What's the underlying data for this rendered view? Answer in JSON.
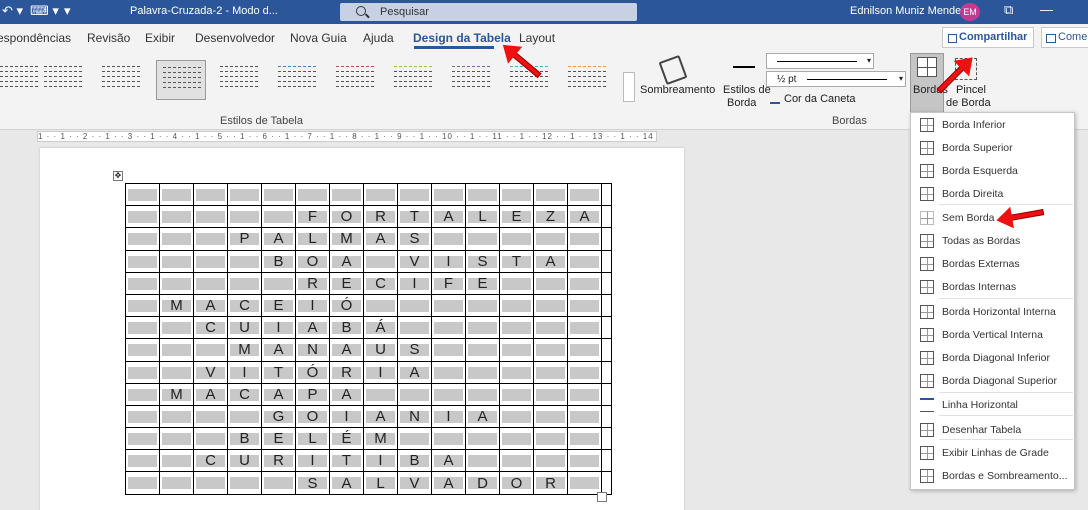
{
  "titlebar": {
    "qa_undo": "↶ ▾",
    "qa_touch": "⌨ ▾",
    "qa_more": "▾",
    "doc_title": "Palavra-Cruzada-2 - Modo d...",
    "search_placeholder": "Pesquisar",
    "user_name": "Ednilson Muniz Mendes",
    "avatar_initials": "EM",
    "restore": "⧉",
    "minimize": "—"
  },
  "tabs": [
    {
      "label": "espondências"
    },
    {
      "label": "Revisão"
    },
    {
      "label": "Exibir"
    },
    {
      "label": "Desenvolvedor"
    },
    {
      "label": "Nova Guia"
    },
    {
      "label": "Ajuda"
    },
    {
      "label": "Design da Tabela"
    },
    {
      "label": "Layout"
    }
  ],
  "share_label": "Compartilhar",
  "comment_label": "Come",
  "ribbon": {
    "styles_group_label": "Estilos de Tabela",
    "shading_label": "Sombreamento",
    "border_styles_label_1": "Estilos de",
    "border_styles_label_2": "Borda",
    "pen_weight": "½ pt",
    "pen_color_label": "Cor da Caneta",
    "borders_button_label": "Bordas",
    "border_painter_label_1": "Pincel",
    "border_painter_label_2": "de Borda",
    "borders_group_label": "Bordas"
  },
  "ruler_text": "1 · · 1 · · 2 · · 1 · · 3 · · 1 · · 4 · · 1 · · 5 · · 1 · · 6 · · 1 · · 7 · · 1 · · 8 · · 1 · · 9 · · 1 · · 10 · · 1 · · 11 · · 1 · · 12 · · 1 · · 13 · · 1 · · 14 · · 1 · · 15 · · 1 · · 16 · · 1 · · 17 · ·",
  "crossword": {
    "rows": [
      [
        "",
        "",
        "",
        "",
        "",
        "",
        "",
        "",
        "",
        "",
        "",
        "",
        "",
        ""
      ],
      [
        "",
        "",
        "",
        "",
        "",
        "F",
        "O",
        "R",
        "T",
        "A",
        "L",
        "E",
        "Z",
        "A"
      ],
      [
        "",
        "",
        "",
        "P",
        "A",
        "L",
        "M",
        "A",
        "S",
        "",
        "",
        "",
        "",
        ""
      ],
      [
        "",
        "",
        "",
        "",
        "B",
        "O",
        "A",
        "",
        "V",
        "I",
        "S",
        "T",
        "A",
        ""
      ],
      [
        "",
        "",
        "",
        "",
        "",
        "R",
        "E",
        "C",
        "I",
        "F",
        "E",
        "",
        "",
        ""
      ],
      [
        "",
        "M",
        "A",
        "C",
        "E",
        "I",
        "Ó",
        "",
        "",
        "",
        "",
        "",
        "",
        ""
      ],
      [
        "",
        "",
        "C",
        "U",
        "I",
        "A",
        "B",
        "Á",
        "",
        "",
        "",
        "",
        "",
        ""
      ],
      [
        "",
        "",
        "",
        "M",
        "A",
        "N",
        "A",
        "U",
        "S",
        "",
        "",
        "",
        "",
        ""
      ],
      [
        "",
        "",
        "V",
        "I",
        "T",
        "Ó",
        "R",
        "I",
        "A",
        "",
        "",
        "",
        "",
        ""
      ],
      [
        "",
        "M",
        "A",
        "C",
        "A",
        "P",
        "A",
        "",
        "",
        "",
        "",
        "",
        "",
        ""
      ],
      [
        "",
        "",
        "",
        "",
        "G",
        "O",
        "I",
        "A",
        "N",
        "I",
        "A",
        "",
        "",
        ""
      ],
      [
        "",
        "",
        "",
        "B",
        "E",
        "L",
        "É",
        "M",
        "",
        "",
        "",
        "",
        "",
        ""
      ],
      [
        "",
        "",
        "C",
        "U",
        "R",
        "I",
        "T",
        "I",
        "B",
        "A",
        "",
        "",
        "",
        ""
      ],
      [
        "",
        "",
        "",
        "",
        "",
        "S",
        "A",
        "L",
        "V",
        "A",
        "D",
        "O",
        "R",
        ""
      ]
    ]
  },
  "borders_menu": [
    {
      "label": "Borda Inferior"
    },
    {
      "label": "Borda Superior"
    },
    {
      "label": "Borda Esquerda"
    },
    {
      "label": "Borda Direita"
    },
    {
      "label": "Sem Borda"
    },
    {
      "label": "Todas as Bordas"
    },
    {
      "label": "Bordas Externas"
    },
    {
      "label": "Bordas Internas"
    },
    {
      "label": "Borda Horizontal Interna"
    },
    {
      "label": "Borda Vertical Interna"
    },
    {
      "label": "Borda Diagonal Inferior"
    },
    {
      "label": "Borda Diagonal Superior"
    },
    {
      "label": "Linha Horizontal"
    },
    {
      "label": "Desenhar Tabela"
    },
    {
      "label": "Exibir Linhas de Grade"
    },
    {
      "label": "Bordas e Sombreamento..."
    }
  ],
  "colors": {
    "accent": "#2b579a",
    "annotation_arrow": "#e11111"
  }
}
